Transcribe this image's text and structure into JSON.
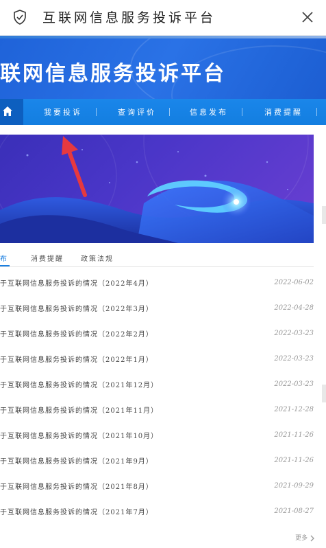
{
  "appbar": {
    "title": "互联网信息服务投诉平台"
  },
  "banner": {
    "heading": "联网信息服务投诉平台"
  },
  "nav": {
    "items": [
      {
        "label": "我要投诉"
      },
      {
        "label": "查询评价"
      },
      {
        "label": "信息发布"
      },
      {
        "label": "消费提醒"
      }
    ]
  },
  "tabs": {
    "items": [
      {
        "label": "布"
      },
      {
        "label": "消费提醒"
      },
      {
        "label": "政策法规"
      }
    ]
  },
  "list": {
    "rows": [
      {
        "text": "于互联网信息服务投诉的情况（2022年4月）",
        "date": "2022-06-02"
      },
      {
        "text": "于互联网信息服务投诉的情况（2022年3月）",
        "date": "2022-04-28"
      },
      {
        "text": "于互联网信息服务投诉的情况（2022年2月）",
        "date": "2022-03-23"
      },
      {
        "text": "于互联网信息服务投诉的情况（2022年1月）",
        "date": "2022-03-23"
      },
      {
        "text": "于互联网信息服务投诉的情况（2021年12月）",
        "date": "2022-03-23"
      },
      {
        "text": "于互联网信息服务投诉的情况（2021年11月）",
        "date": "2021-12-28"
      },
      {
        "text": "于互联网信息服务投诉的情况（2021年10月）",
        "date": "2021-11-26"
      },
      {
        "text": "于互联网信息服务投诉的情况（2021年9月）",
        "date": "2021-11-26"
      },
      {
        "text": "于互联网信息服务投诉的情况（2021年8月）",
        "date": "2021-09-29"
      },
      {
        "text": "于互联网信息服务投诉的情况（2021年7月）",
        "date": "2021-08-27"
      }
    ],
    "more_label": "更多"
  },
  "colors": {
    "nav_blue": "#1a86ea",
    "banner_blue": "#1f63d9",
    "accent": "#1b7fe0",
    "arrow_red": "#e6393f"
  },
  "icons": [
    "shield-check-icon",
    "close-icon",
    "home-icon",
    "chevron-right-icon",
    "arrow-pointer"
  ]
}
